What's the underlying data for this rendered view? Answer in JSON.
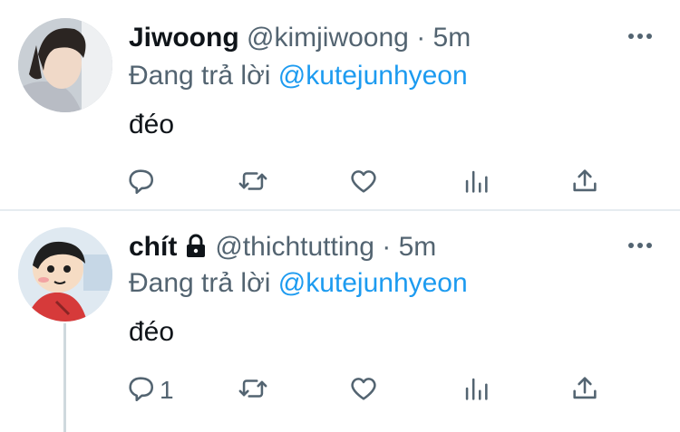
{
  "tweets": [
    {
      "name": "Jiwoong",
      "handle": "@kimjiwoong",
      "separator": "·",
      "time": "5m",
      "locked": false,
      "replying_prefix": "Đang trả lời",
      "replying_to": "@kutejunhyeon",
      "text": "đéo",
      "reply_count": "",
      "avatar_icon": "user-photo"
    },
    {
      "name": "chít",
      "handle": "@thichtutting",
      "separator": "·",
      "time": "5m",
      "locked": true,
      "replying_prefix": "Đang trả lời",
      "replying_to": "@kutejunhyeon",
      "text": "đéo",
      "reply_count": "1",
      "avatar_icon": "cartoon-character"
    }
  ],
  "icons": [
    "reply-icon",
    "retweet-icon",
    "like-icon",
    "analytics-icon",
    "share-icon",
    "more-icon",
    "lock-icon"
  ],
  "colors": {
    "accent": "#1d9bf0",
    "muted": "#536471",
    "text": "#0f1419",
    "divider": "#e6ecf0"
  }
}
